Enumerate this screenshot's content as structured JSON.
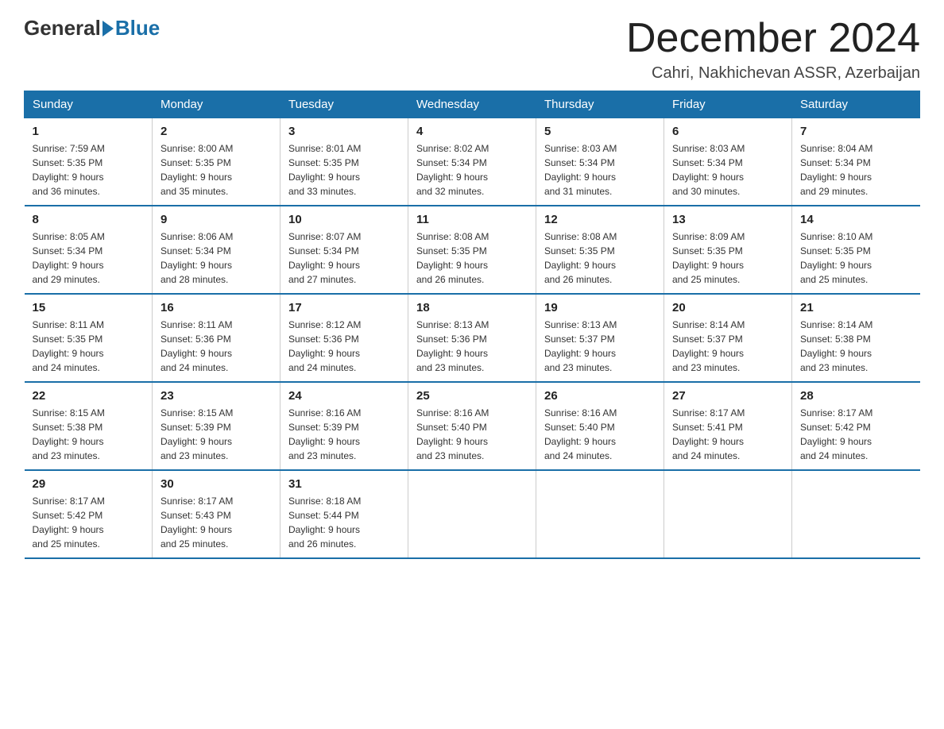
{
  "logo": {
    "general": "General",
    "blue": "Blue"
  },
  "header": {
    "month_year": "December 2024",
    "location": "Cahri, Nakhichevan ASSR, Azerbaijan"
  },
  "weekdays": [
    "Sunday",
    "Monday",
    "Tuesday",
    "Wednesday",
    "Thursday",
    "Friday",
    "Saturday"
  ],
  "weeks": [
    [
      {
        "day": "1",
        "sunrise": "7:59 AM",
        "sunset": "5:35 PM",
        "daylight": "9 hours and 36 minutes."
      },
      {
        "day": "2",
        "sunrise": "8:00 AM",
        "sunset": "5:35 PM",
        "daylight": "9 hours and 35 minutes."
      },
      {
        "day": "3",
        "sunrise": "8:01 AM",
        "sunset": "5:35 PM",
        "daylight": "9 hours and 33 minutes."
      },
      {
        "day": "4",
        "sunrise": "8:02 AM",
        "sunset": "5:34 PM",
        "daylight": "9 hours and 32 minutes."
      },
      {
        "day": "5",
        "sunrise": "8:03 AM",
        "sunset": "5:34 PM",
        "daylight": "9 hours and 31 minutes."
      },
      {
        "day": "6",
        "sunrise": "8:03 AM",
        "sunset": "5:34 PM",
        "daylight": "9 hours and 30 minutes."
      },
      {
        "day": "7",
        "sunrise": "8:04 AM",
        "sunset": "5:34 PM",
        "daylight": "9 hours and 29 minutes."
      }
    ],
    [
      {
        "day": "8",
        "sunrise": "8:05 AM",
        "sunset": "5:34 PM",
        "daylight": "9 hours and 29 minutes."
      },
      {
        "day": "9",
        "sunrise": "8:06 AM",
        "sunset": "5:34 PM",
        "daylight": "9 hours and 28 minutes."
      },
      {
        "day": "10",
        "sunrise": "8:07 AM",
        "sunset": "5:34 PM",
        "daylight": "9 hours and 27 minutes."
      },
      {
        "day": "11",
        "sunrise": "8:08 AM",
        "sunset": "5:35 PM",
        "daylight": "9 hours and 26 minutes."
      },
      {
        "day": "12",
        "sunrise": "8:08 AM",
        "sunset": "5:35 PM",
        "daylight": "9 hours and 26 minutes."
      },
      {
        "day": "13",
        "sunrise": "8:09 AM",
        "sunset": "5:35 PM",
        "daylight": "9 hours and 25 minutes."
      },
      {
        "day": "14",
        "sunrise": "8:10 AM",
        "sunset": "5:35 PM",
        "daylight": "9 hours and 25 minutes."
      }
    ],
    [
      {
        "day": "15",
        "sunrise": "8:11 AM",
        "sunset": "5:35 PM",
        "daylight": "9 hours and 24 minutes."
      },
      {
        "day": "16",
        "sunrise": "8:11 AM",
        "sunset": "5:36 PM",
        "daylight": "9 hours and 24 minutes."
      },
      {
        "day": "17",
        "sunrise": "8:12 AM",
        "sunset": "5:36 PM",
        "daylight": "9 hours and 24 minutes."
      },
      {
        "day": "18",
        "sunrise": "8:13 AM",
        "sunset": "5:36 PM",
        "daylight": "9 hours and 23 minutes."
      },
      {
        "day": "19",
        "sunrise": "8:13 AM",
        "sunset": "5:37 PM",
        "daylight": "9 hours and 23 minutes."
      },
      {
        "day": "20",
        "sunrise": "8:14 AM",
        "sunset": "5:37 PM",
        "daylight": "9 hours and 23 minutes."
      },
      {
        "day": "21",
        "sunrise": "8:14 AM",
        "sunset": "5:38 PM",
        "daylight": "9 hours and 23 minutes."
      }
    ],
    [
      {
        "day": "22",
        "sunrise": "8:15 AM",
        "sunset": "5:38 PM",
        "daylight": "9 hours and 23 minutes."
      },
      {
        "day": "23",
        "sunrise": "8:15 AM",
        "sunset": "5:39 PM",
        "daylight": "9 hours and 23 minutes."
      },
      {
        "day": "24",
        "sunrise": "8:16 AM",
        "sunset": "5:39 PM",
        "daylight": "9 hours and 23 minutes."
      },
      {
        "day": "25",
        "sunrise": "8:16 AM",
        "sunset": "5:40 PM",
        "daylight": "9 hours and 23 minutes."
      },
      {
        "day": "26",
        "sunrise": "8:16 AM",
        "sunset": "5:40 PM",
        "daylight": "9 hours and 24 minutes."
      },
      {
        "day": "27",
        "sunrise": "8:17 AM",
        "sunset": "5:41 PM",
        "daylight": "9 hours and 24 minutes."
      },
      {
        "day": "28",
        "sunrise": "8:17 AM",
        "sunset": "5:42 PM",
        "daylight": "9 hours and 24 minutes."
      }
    ],
    [
      {
        "day": "29",
        "sunrise": "8:17 AM",
        "sunset": "5:42 PM",
        "daylight": "9 hours and 25 minutes."
      },
      {
        "day": "30",
        "sunrise": "8:17 AM",
        "sunset": "5:43 PM",
        "daylight": "9 hours and 25 minutes."
      },
      {
        "day": "31",
        "sunrise": "8:18 AM",
        "sunset": "5:44 PM",
        "daylight": "9 hours and 26 minutes."
      },
      null,
      null,
      null,
      null
    ]
  ],
  "labels": {
    "sunrise": "Sunrise:",
    "sunset": "Sunset:",
    "daylight": "Daylight:"
  }
}
